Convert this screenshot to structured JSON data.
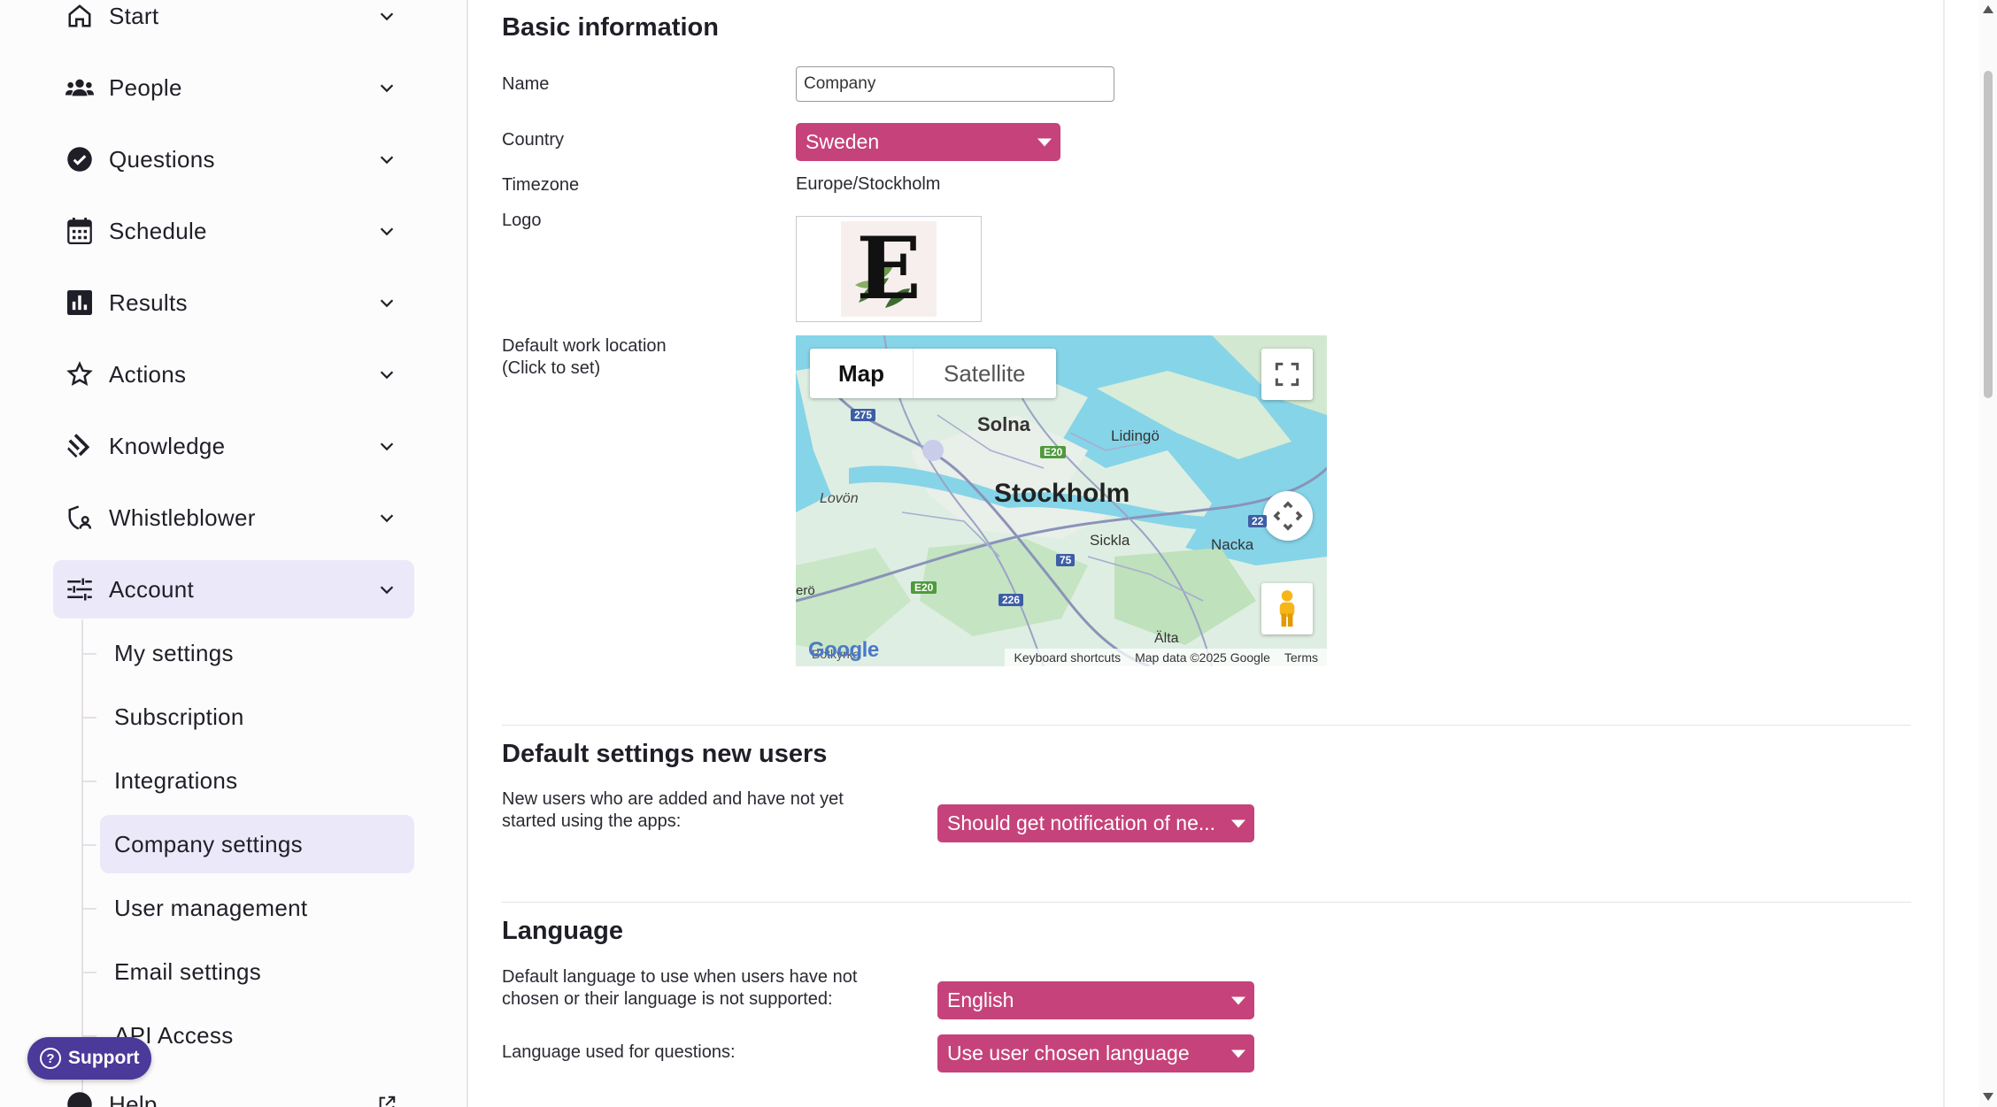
{
  "sidebar": {
    "items": [
      {
        "label": "Start",
        "icon": "home-icon"
      },
      {
        "label": "People",
        "icon": "people-icon"
      },
      {
        "label": "Questions",
        "icon": "check-circle-icon"
      },
      {
        "label": "Schedule",
        "icon": "calendar-icon"
      },
      {
        "label": "Results",
        "icon": "bar-chart-icon"
      },
      {
        "label": "Actions",
        "icon": "star-icon"
      },
      {
        "label": "Knowledge",
        "icon": "knowledge-icon"
      },
      {
        "label": "Whistleblower",
        "icon": "shield-person-icon"
      },
      {
        "label": "Account",
        "icon": "sliders-icon"
      }
    ],
    "account_sub": [
      {
        "label": "My settings"
      },
      {
        "label": "Subscription"
      },
      {
        "label": "Integrations"
      },
      {
        "label": "Company settings"
      },
      {
        "label": "User management"
      },
      {
        "label": "Email settings"
      },
      {
        "label": "API Access"
      }
    ],
    "help_label": "Help",
    "support_label": "Support"
  },
  "basic": {
    "title": "Basic information",
    "name_label": "Name",
    "name_value": "Company",
    "country_label": "Country",
    "country_value": "Sweden",
    "timezone_label": "Timezone",
    "timezone_value": "Europe/Stockholm",
    "logo_label": "Logo",
    "logo_letter": "E",
    "location_label_1": "Default work location",
    "location_label_2": "(Click to set)"
  },
  "map": {
    "tab_map": "Map",
    "tab_satellite": "Satellite",
    "labels": {
      "solna": "Solna",
      "lidingo": "Lidingö",
      "stockholm": "Stockholm",
      "lovon": "Lovön",
      "sickla": "Sickla",
      "nacka": "Nacka",
      "alta": "Älta",
      "botkyrka": "Botkyrka",
      "ero": "erö"
    },
    "shields": {
      "r275": "275",
      "e20a": "E20",
      "r75": "75",
      "e20b": "E20",
      "r226": "226",
      "r22": "22"
    },
    "google": "Google",
    "footer_shortcuts": "Keyboard shortcuts",
    "footer_data": "Map data ©2025 Google",
    "footer_terms": "Terms"
  },
  "new_users": {
    "title": "Default settings new users",
    "desc_1": "New users who are added and have not yet",
    "desc_2": "started using the apps:",
    "select_value": "Should get notification of ne..."
  },
  "language": {
    "title": "Language",
    "default_desc_1": "Default language to use when users have not",
    "default_desc_2": "chosen or their language is not supported:",
    "default_value": "English",
    "questions_label": "Language used for questions:",
    "questions_value": "Use user chosen language"
  },
  "colors": {
    "accent": "#c5437a",
    "active_nav": "#ebe8f9",
    "support": "#4b3a99"
  }
}
